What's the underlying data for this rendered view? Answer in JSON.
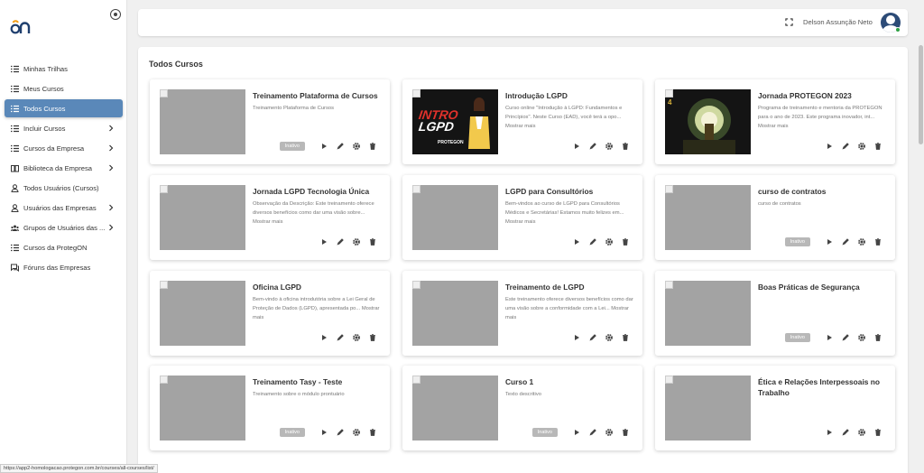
{
  "sidebar": {
    "items": [
      {
        "label": "Minhas Trilhas",
        "icon": "list-icon",
        "chevron": false,
        "active": false
      },
      {
        "label": "Meus Cursos",
        "icon": "list-icon",
        "chevron": false,
        "active": false
      },
      {
        "label": "Todos Cursos",
        "icon": "list-icon",
        "chevron": false,
        "active": true
      },
      {
        "label": "Incluir Cursos",
        "icon": "list-icon",
        "chevron": true,
        "active": false
      },
      {
        "label": "Cursos da Empresa",
        "icon": "list-icon",
        "chevron": true,
        "active": false
      },
      {
        "label": "Biblioteca da Empresa",
        "icon": "book-icon",
        "chevron": true,
        "active": false
      },
      {
        "label": "Todos Usuários (Cursos)",
        "icon": "user-icon",
        "chevron": false,
        "active": false
      },
      {
        "label": "Usuários das Empresas",
        "icon": "user-icon",
        "chevron": true,
        "active": false
      },
      {
        "label": "Grupos de Usuários das ...",
        "icon": "group-icon",
        "chevron": true,
        "active": false
      },
      {
        "label": "Cursos da ProtegON",
        "icon": "list-icon",
        "chevron": false,
        "active": false
      },
      {
        "label": "Fóruns das Empresas",
        "icon": "forum-icon",
        "chevron": false,
        "active": false
      }
    ]
  },
  "header": {
    "user_name": "Delson Assunção Neto"
  },
  "main": {
    "title": "Todos Cursos",
    "badge_label": "Inativo",
    "courses": [
      {
        "title": "Treinamento Plataforma de Cursos",
        "description": "Treinamento Plataforma de Cursos",
        "inactive": true,
        "thumb": "placeholder"
      },
      {
        "title": "Introdução LGPD",
        "description": "Curso online \"Introdução à LGPD: Fundamentos e Princípios\". Neste Curso (EAD), você terá a opo... Mostrar mais",
        "inactive": false,
        "thumb": "intro-lgpd"
      },
      {
        "title": "Jornada PROTEGON 2023",
        "description": "Programa de treinamento e mentoria da PROTEGON para o ano de 2023. Este programa inovador, int... Mostrar mais",
        "inactive": false,
        "thumb": "jornada"
      },
      {
        "title": "Jornada LGPD Tecnologia Única",
        "description": "Observação da Descrição: Este treinamento oferece diversos benefícios como dar uma visão sobre... Mostrar mais",
        "inactive": false,
        "thumb": "placeholder"
      },
      {
        "title": "LGPD para Consultórios",
        "description": "Bem-vindos ao curso de LGPD para Consultórios Médicos e Secretárias! Estamos muito felizes em... Mostrar mais",
        "inactive": false,
        "thumb": "placeholder"
      },
      {
        "title": "curso de contratos",
        "description": "curso de contratos",
        "inactive": true,
        "thumb": "placeholder"
      },
      {
        "title": "Oficina LGPD",
        "description": "Bem-vindo à oficina introdutória sobre a Lei Geral de Proteção de Dados (LGPD), apresentada po... Mostrar mais",
        "inactive": false,
        "thumb": "placeholder"
      },
      {
        "title": "Treinamento de LGPD",
        "description": "Este treinamento oferece diversos benefícios como dar uma visão sobre a conformidade com a Lei... Mostrar mais",
        "inactive": false,
        "thumb": "placeholder"
      },
      {
        "title": "Boas Práticas de Segurança",
        "description": "",
        "inactive": true,
        "thumb": "placeholder"
      },
      {
        "title": "Treinamento Tasy - Teste",
        "description": "Treinamento sobre o módulo prontuário",
        "inactive": true,
        "thumb": "placeholder"
      },
      {
        "title": "Curso 1",
        "description": "Texto descritivo",
        "inactive": true,
        "thumb": "placeholder"
      },
      {
        "title": "Ética e Relações Interpessoais no Trabalho",
        "description": "",
        "inactive": false,
        "thumb": "placeholder"
      }
    ]
  },
  "promo": {
    "intro_line1": "INTRO",
    "intro_line2": "LGPD",
    "intro_brand": "PROTEGON",
    "jornada_num": "4"
  },
  "statusbar": {
    "url": "https://app2-homologacao.protegon.com.br/courses/all-courses/list/"
  },
  "colors": {
    "active_nav": "#5a88b9",
    "badge": "#b8b8b8",
    "avatar": "#2c4b77",
    "online": "#2ea043"
  }
}
